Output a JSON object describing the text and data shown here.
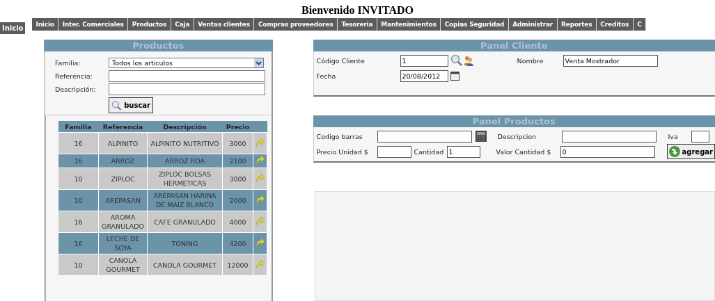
{
  "page_title": "Bienvenido INVITADO",
  "home_badge": "Inicio",
  "menu": [
    {
      "label": "Inicio"
    },
    {
      "label": "Inter. Comerciales"
    },
    {
      "label": "Productos"
    },
    {
      "label": "Caja"
    },
    {
      "label": "Ventas clientes"
    },
    {
      "label": "Compras proveedores"
    },
    {
      "label": "Tesoreria"
    },
    {
      "label": "Mantenimientos"
    },
    {
      "label": "Copias Seguridad"
    },
    {
      "label": "Administrar"
    },
    {
      "label": "Reportes"
    },
    {
      "label": "Creditos"
    },
    {
      "label": "C"
    }
  ],
  "products_panel": {
    "title": "Productos",
    "fields": [
      {
        "label": "Familia:",
        "kind": "select",
        "value": "Todos los articulos"
      },
      {
        "label": "Referencia:",
        "kind": "text"
      },
      {
        "label": "Descripción:",
        "kind": "text"
      }
    ],
    "search_button": "buscar",
    "table": {
      "columns": [
        "Familia",
        "Referencia",
        "Descripción",
        "Precio"
      ],
      "rows": [
        {
          "cells": [
            "16",
            "ALPINITO",
            "ALPINITO NUTRITIVO",
            "3000"
          ]
        },
        {
          "cells": [
            "16",
            "ARROZ",
            "ARROZ ROA",
            "2100"
          ]
        },
        {
          "cells": [
            "10",
            "ZIPLOC",
            "ZIPLOC BOLSAS HERMETICAS",
            "3000"
          ]
        },
        {
          "cells": [
            "10",
            "AREPASAN",
            "AREPASAN HARINA DE MAIZ BLANCO",
            "2000"
          ]
        },
        {
          "cells": [
            "16",
            "AROMA GRANULADO",
            "CAFE GRANULADO",
            "4000"
          ]
        },
        {
          "cells": [
            "16",
            "LECHE DE SOYA",
            "TONING",
            "4200"
          ]
        },
        {
          "cells": [
            "10",
            "CANOLA GOURMET",
            "CANOLA GOURMET",
            "12000"
          ]
        }
      ]
    }
  },
  "client_panel": {
    "title": "Panel Cliente",
    "code_label": "Código Cliente",
    "code_value": "1",
    "name_label": "Nombre",
    "name_value": "Venta Mostrador",
    "date_label": "Fecha",
    "date_value": "20/08/2012"
  },
  "product_entry_panel": {
    "title": "Panel Productos",
    "barcode_label": "Codigo barras",
    "description_label": "Descripcion",
    "iva_label": "Iva",
    "unit_price_label": "Precio Unidad $",
    "quantity_label": "Cantidad",
    "quantity_value": "1",
    "total_label": "Valor Cantidad $",
    "total_value": "0",
    "add_button": "agregar"
  }
}
